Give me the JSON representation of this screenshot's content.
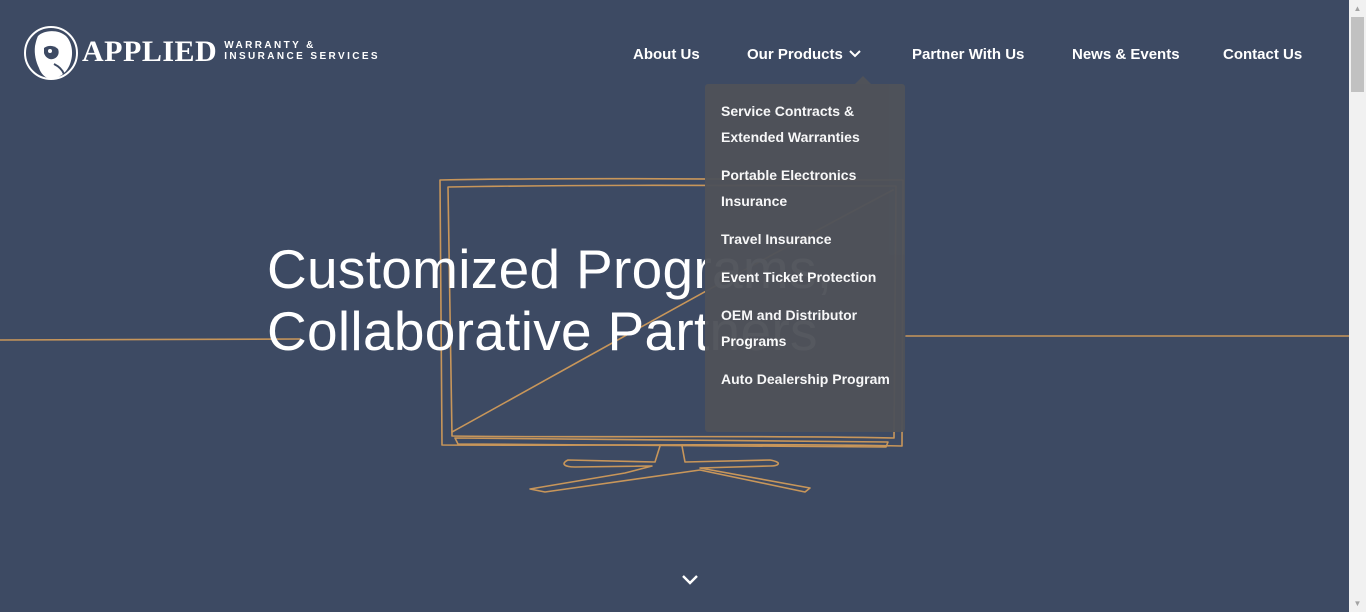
{
  "brand": {
    "name": "APPLIED",
    "tagline_line1": "WARRANTY &",
    "tagline_line2": "INSURANCE SERVICES",
    "logo_icon": "dog-head-icon"
  },
  "nav": {
    "items": [
      {
        "label": "About Us"
      },
      {
        "label": "Our Products"
      },
      {
        "label": "Partner With Us"
      },
      {
        "label": "News & Events"
      },
      {
        "label": "Contact Us"
      }
    ]
  },
  "products_menu": {
    "items": [
      {
        "label": "Service Contracts & Extended Warranties"
      },
      {
        "label": "Portable Electronics Insurance"
      },
      {
        "label": "Travel Insurance"
      },
      {
        "label": "Event Ticket Protection"
      },
      {
        "label": "OEM and Distributor Programs"
      },
      {
        "label": "Auto Dealership Program"
      }
    ]
  },
  "hero": {
    "line1": "Customized Programs,",
    "line2": "Collaborative Partners"
  },
  "colors": {
    "background": "#3d4a63",
    "dropdown": "#4f5259",
    "line_art": "#c8965a"
  }
}
